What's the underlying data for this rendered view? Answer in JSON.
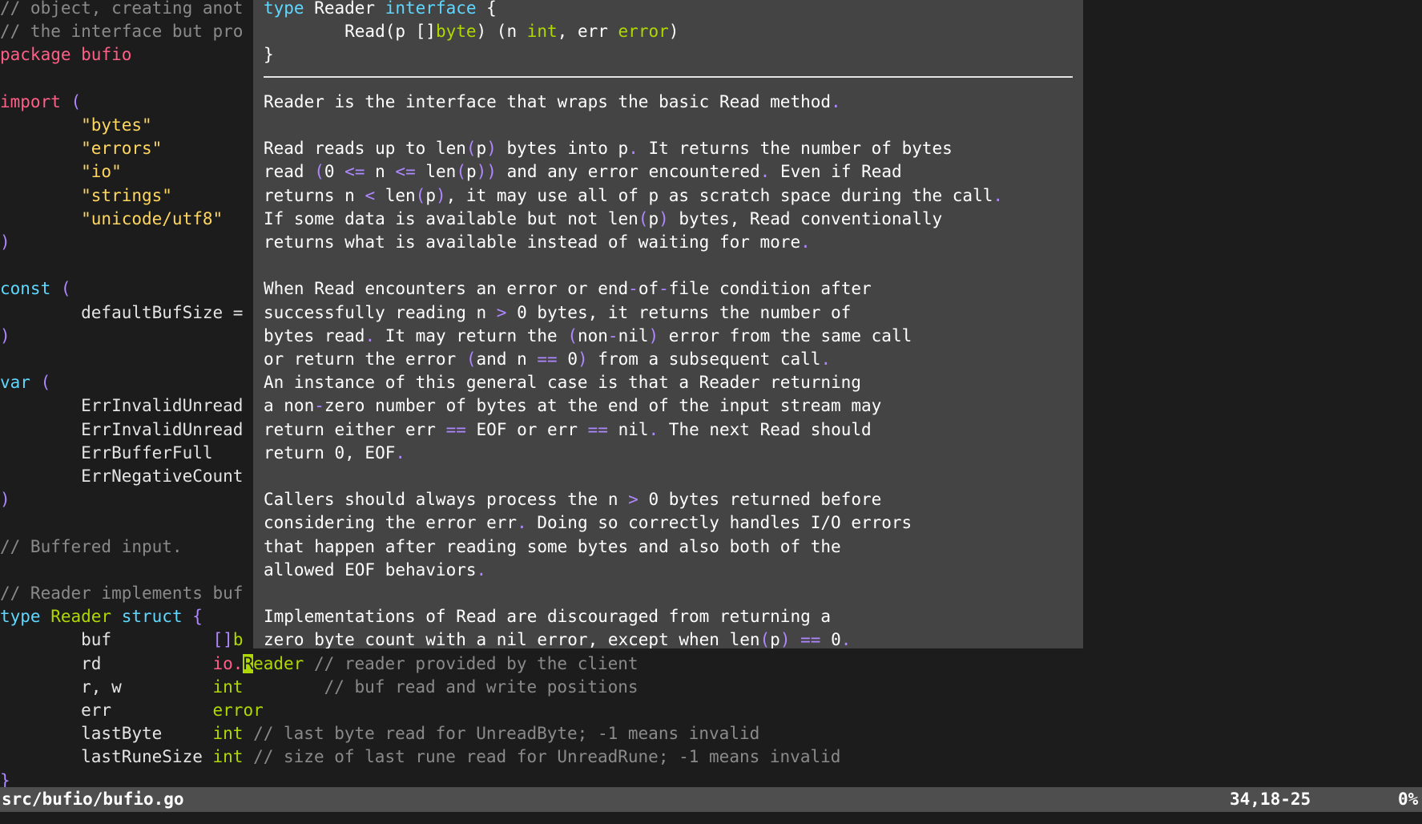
{
  "editor": {
    "lines": [
      {
        "text": "// object, creating anot",
        "kind": "comment"
      },
      {
        "text": "// the interface but pro",
        "kind": "comment"
      },
      {
        "text": "package bufio",
        "kind": "package"
      },
      {
        "text": "",
        "kind": "blank"
      },
      {
        "text": "import (",
        "kind": "import-open"
      },
      {
        "text": "\t\"bytes\"",
        "kind": "string"
      },
      {
        "text": "\t\"errors\"",
        "kind": "string"
      },
      {
        "text": "\t\"io\"",
        "kind": "string"
      },
      {
        "text": "\t\"strings\"",
        "kind": "string"
      },
      {
        "text": "\t\"unicode/utf8\"",
        "kind": "string"
      },
      {
        "text": ")",
        "kind": "paren"
      },
      {
        "text": "",
        "kind": "blank"
      },
      {
        "text": "const (",
        "kind": "const-open"
      },
      {
        "text": "\tdefaultBufSize =",
        "kind": "plain"
      },
      {
        "text": ")",
        "kind": "paren"
      },
      {
        "text": "",
        "kind": "blank"
      },
      {
        "text": "var (",
        "kind": "var-open"
      },
      {
        "text": "\tErrInvalidUnread",
        "kind": "plain"
      },
      {
        "text": "\tErrInvalidUnread",
        "kind": "plain"
      },
      {
        "text": "\tErrBufferFull",
        "kind": "plain"
      },
      {
        "text": "\tErrNegativeCount",
        "kind": "plain"
      },
      {
        "text": ")",
        "kind": "paren"
      },
      {
        "text": "",
        "kind": "blank"
      },
      {
        "text": "// Buffered input.",
        "kind": "comment"
      },
      {
        "text": "",
        "kind": "blank"
      },
      {
        "text": "// Reader implements buf",
        "kind": "comment"
      }
    ],
    "struct_header": {
      "type_kw": "type",
      "name": "Reader",
      "struct_kw": "struct",
      "brace": "{"
    },
    "fields": [
      {
        "name": "buf",
        "type": "[]b",
        "comment": ""
      },
      {
        "name": "rd",
        "type": "io.",
        "cursor_char": "R",
        "type_rest": "eader",
        "comment": "// reader provided by the client"
      },
      {
        "name": "r, w",
        "type": "int",
        "comment": "// buf read and write positions"
      },
      {
        "name": "err",
        "type": "error",
        "comment": ""
      },
      {
        "name": "lastByte",
        "type": "int",
        "comment": "// last byte read for UnreadByte; -1 means invalid"
      },
      {
        "name": "lastRuneSize",
        "type": "int",
        "comment": "// size of last rune read for UnreadRune; -1 means invalid"
      }
    ],
    "closing_brace": "}"
  },
  "popup": {
    "signature": {
      "line1_type": "type",
      "line1_name": "Reader",
      "line1_kw": "interface",
      "line1_brace": "{",
      "line2_method": "Read(p []",
      "line2_byte": "byte",
      "line2_mid": ") (n ",
      "line2_int": "int",
      "line2_err": ", err ",
      "line2_error": "error",
      "line2_close": ")",
      "line3": "}"
    },
    "doc": [
      "Reader is the interface that wraps the basic Read method.",
      "",
      "Read reads up to len(p) bytes into p. It returns the number of bytes",
      "read (0 <= n <= len(p)) and any error encountered. Even if Read",
      "returns n < len(p), it may use all of p as scratch space during the call.",
      "If some data is available but not len(p) bytes, Read conventionally",
      "returns what is available instead of waiting for more.",
      "",
      "When Read encounters an error or end-of-file condition after",
      "successfully reading n > 0 bytes, it returns the number of",
      "bytes read. It may return the (non-nil) error from the same call",
      "or return the error (and n == 0) from a subsequent call.",
      "An instance of this general case is that a Reader returning",
      "a non-zero number of bytes at the end of the input stream may",
      "return either err == EOF or err == nil. The next Read should",
      "return 0, EOF.",
      "",
      "Callers should always process the n > 0 bytes returned before",
      "considering the error err. Doing so correctly handles I/O errors",
      "that happen after reading some bytes and also both of the",
      "allowed EOF behaviors.",
      "",
      "Implementations of Read are discouraged from returning a",
      "zero byte count with a nil error, except when len(p) == 0."
    ]
  },
  "statusbar": {
    "file": "src/bufio/bufio.go",
    "position": "34,18-25",
    "percent": "0%"
  },
  "colors": {
    "background": "#1c1c1c",
    "popup_bg": "#444444",
    "keyword": "#ff5f87",
    "keyword_blue": "#5fd7ff",
    "string": "#ffd75f",
    "punct": "#af87ff",
    "comment": "#8a8a8a",
    "type": "#afd700",
    "statusbar_bg": "#4e4e4e"
  }
}
